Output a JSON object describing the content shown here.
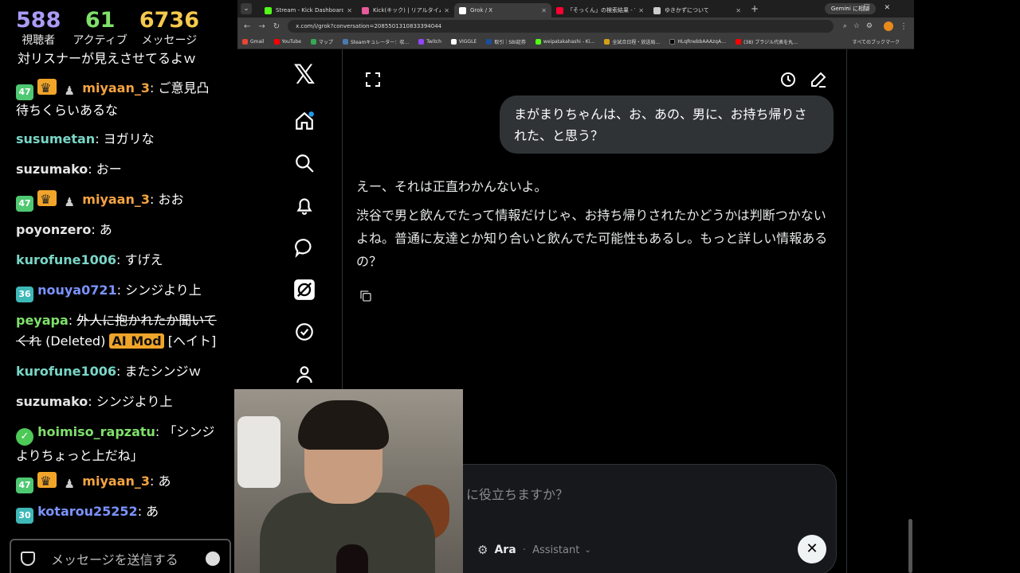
{
  "stats": [
    {
      "value": "588",
      "label": "視聴者",
      "color": "#a99cf5"
    },
    {
      "value": "61",
      "label": "アクティブ",
      "color": "#7fe06b"
    },
    {
      "value": "6736",
      "label": "メッセージ",
      "color": "#f5c94e"
    }
  ],
  "chat": {
    "cut_text": "対リスナーが見えさせてるよｗ",
    "messages": [
      {
        "user": "miyaan_3",
        "text": "ご意見凸待ちくらいあるな",
        "user_color": "#f5a442",
        "badges": [
          "sub-47",
          "crown",
          "bot"
        ],
        "badge_num": "47"
      },
      {
        "user": "susumetan",
        "text": "ヨガリな",
        "user_color": "#79d6c7"
      },
      {
        "user": "suzumako",
        "text": "おー",
        "user_color": "#e4e4e4"
      },
      {
        "user": "miyaan_3",
        "text": "おお",
        "user_color": "#f5a442",
        "badges": [
          "sub-47",
          "crown",
          "bot"
        ],
        "badge_num": "47"
      },
      {
        "user": "poyonzero",
        "text": "あ",
        "user_color": "#e4e4e4"
      },
      {
        "user": "kurofune1006",
        "text": "すげえ",
        "user_color": "#79d6c7"
      },
      {
        "user": "nouya0721",
        "text": "シンジより上",
        "user_color": "#7b93ff",
        "badge_num": "36"
      },
      {
        "user": "peyapa",
        "text": "外人に抱かれたか聞いてくれ",
        "user_color": "#7fe06b",
        "deleted": "(Deleted)",
        "mod": "AI Mod",
        "tag": "[ヘイト]"
      },
      {
        "user": "kurofune1006",
        "text": "またシンジｗ",
        "user_color": "#79d6c7"
      },
      {
        "user": "suzumako",
        "text": "シンジより上",
        "user_color": "#e4e4e4"
      },
      {
        "user": "hoimiso_rapzatu",
        "text": "「シンジよりちょっと上だね」",
        "user_color": "#7fe06b"
      },
      {
        "user": "miyaan_3",
        "text": "あ",
        "user_color": "#f5a442",
        "badge_num": "47"
      },
      {
        "user": "kotarou25252",
        "text": "あ",
        "user_color": "#7b93ff",
        "badge_num": "30"
      }
    ],
    "input_placeholder": "メッセージを送信する"
  },
  "browser": {
    "tabs": [
      {
        "title": "Stream - Kick Dashboard",
        "fav_color": "#53fc18"
      },
      {
        "title": "Kick(キック) | リアルタイムランキング",
        "fav_color": "#e85a9a"
      },
      {
        "title": "Grok / X",
        "fav_color": "#ffffff",
        "active": true
      },
      {
        "title": "「そっくん」の検索結果 - Yahoo!検",
        "fav_color": "#ff0033"
      },
      {
        "title": "ゆきかずについて",
        "fav_color": "#cccccc"
      }
    ],
    "gemini_label": "Gemini に相談",
    "url": "x.com/i/grok?conversation=2085501310833394044",
    "bookmarks": [
      {
        "label": "Gmail",
        "color": "#ea4335"
      },
      {
        "label": "YouTube",
        "color": "#ff0000"
      },
      {
        "label": "マップ",
        "color": "#34a853"
      },
      {
        "label": "Steamキュレーター：収…",
        "color": "#1b2838"
      },
      {
        "label": "Twitch",
        "color": "#9146ff"
      },
      {
        "label": "VIGGLE",
        "color": "#ffffff"
      },
      {
        "label": "取引｜SBI証券",
        "color": "#1a4fa0"
      },
      {
        "label": "weipatakahashi - Ki…",
        "color": "#53fc18"
      },
      {
        "label": "全試合日程・放送局…",
        "color": "#d4a017"
      },
      {
        "label": "HLqRnebbAAAzqA…",
        "color": "#000000"
      },
      {
        "label": "(38) ブラジル代表を丸…",
        "color": "#ff0000"
      }
    ],
    "bookmarks_right": "すべてのブックマーク"
  },
  "grok": {
    "user_message": "まがまりちゃんは、お、あの、男に、お持ち帰りされた、と思う？",
    "reply_paragraphs": [
      "えー、それは正直わかんないよ。",
      "渋谷で男と飲んでたって情報だけじゃ、お持ち帰りされたかどうかは判断つかないよね。普通に友達とか知り合いと飲んでた可能性もあるし。もっと詳しい情報あるの？"
    ],
    "input_placeholder": "に役立ちますか？",
    "model_name": "Ara",
    "model_role": "Assistant"
  }
}
